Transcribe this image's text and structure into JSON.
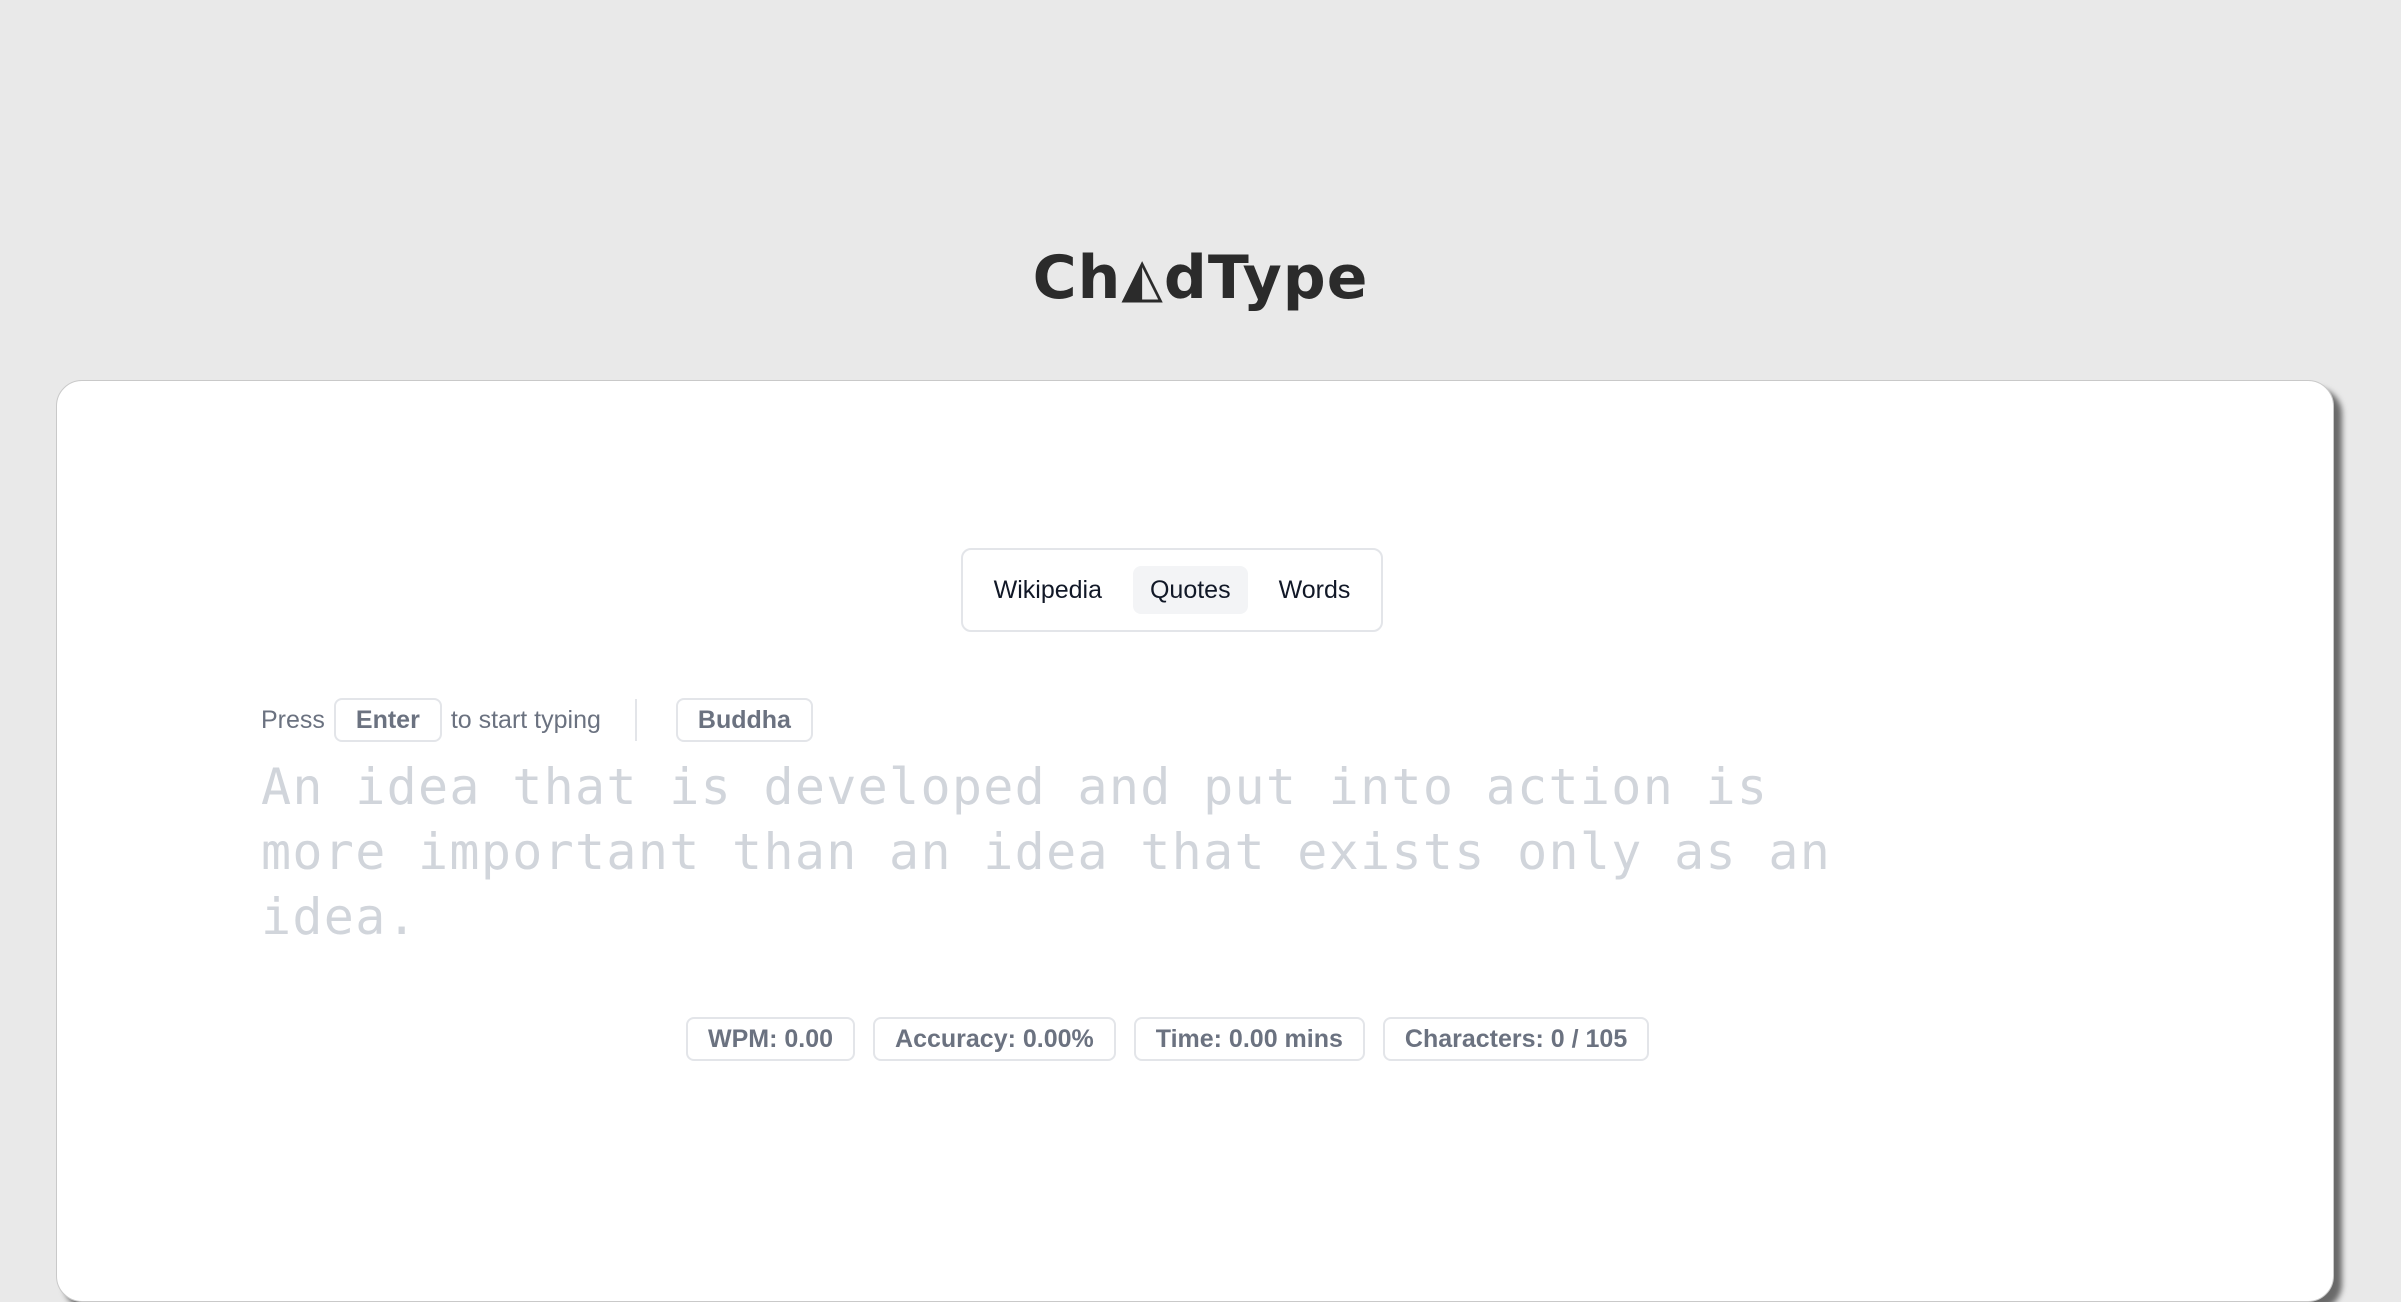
{
  "app": {
    "logo_prefix": "Ch",
    "logo_glyph": "◭",
    "logo_suffix": "dType"
  },
  "tabs": [
    {
      "label": "Wikipedia",
      "active": false
    },
    {
      "label": "Quotes",
      "active": true
    },
    {
      "label": "Words",
      "active": false
    }
  ],
  "hint": {
    "press": "Press",
    "key": "Enter",
    "rest": "to start typing",
    "author": "Buddha"
  },
  "quote": {
    "text": "An idea that is developed and put into action is more important than an idea that exists only as an idea."
  },
  "stats": {
    "wpm": "WPM: 0.00",
    "accuracy": "Accuracy: 0.00%",
    "time": "Time: 0.00 mins",
    "characters": "Characters: 0 / 105"
  }
}
